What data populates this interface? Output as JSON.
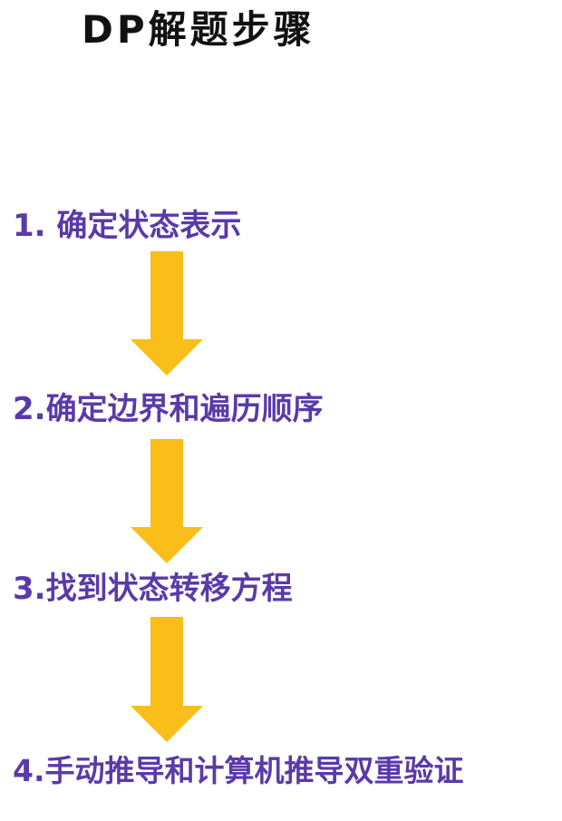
{
  "title": "DP解题步骤",
  "steps": [
    {
      "label": "1. 确定状态表示"
    },
    {
      "label": "2.确定边界和遍历顺序"
    },
    {
      "label": "3.找到状态转移方程"
    },
    {
      "label": "4.手动推导和计算机推导双重验证"
    }
  ],
  "colors": {
    "title": "#111111",
    "step_text": "#5a3aa8",
    "arrow": "#f9be1a",
    "background": "#ffffff"
  },
  "icons": [
    "arrow-down-icon",
    "arrow-down-icon",
    "arrow-down-icon"
  ]
}
